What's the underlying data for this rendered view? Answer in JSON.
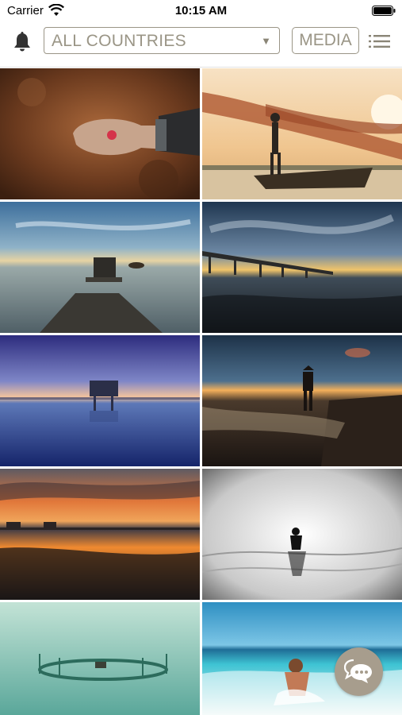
{
  "status_bar": {
    "carrier": "Carrier",
    "time": "10:15 AM"
  },
  "toolbar": {
    "country_filter": "ALL COUNTRIES",
    "media_label": "MEDIA"
  },
  "icons": {
    "notifications": "bell-icon",
    "menu": "list-icon",
    "chat": "chat-bubbles-icon"
  },
  "gallery": [
    {
      "subject": "weathered hand holding red seed"
    },
    {
      "subject": "fisherman with net on boat at sunset"
    },
    {
      "subject": "wooden pier into calm sea"
    },
    {
      "subject": "long jetty under dramatic sky"
    },
    {
      "subject": "stilt hut on blue lagoon"
    },
    {
      "subject": "figure wading at dusk"
    },
    {
      "subject": "orange sunset over tidal flats"
    },
    {
      "subject": "monochrome wader in water"
    },
    {
      "subject": "fish trap in teal water"
    },
    {
      "subject": "child splashing in turquoise sea"
    }
  ],
  "colors": {
    "accent": "#9a9586",
    "chat_button": "#a79d8d"
  }
}
